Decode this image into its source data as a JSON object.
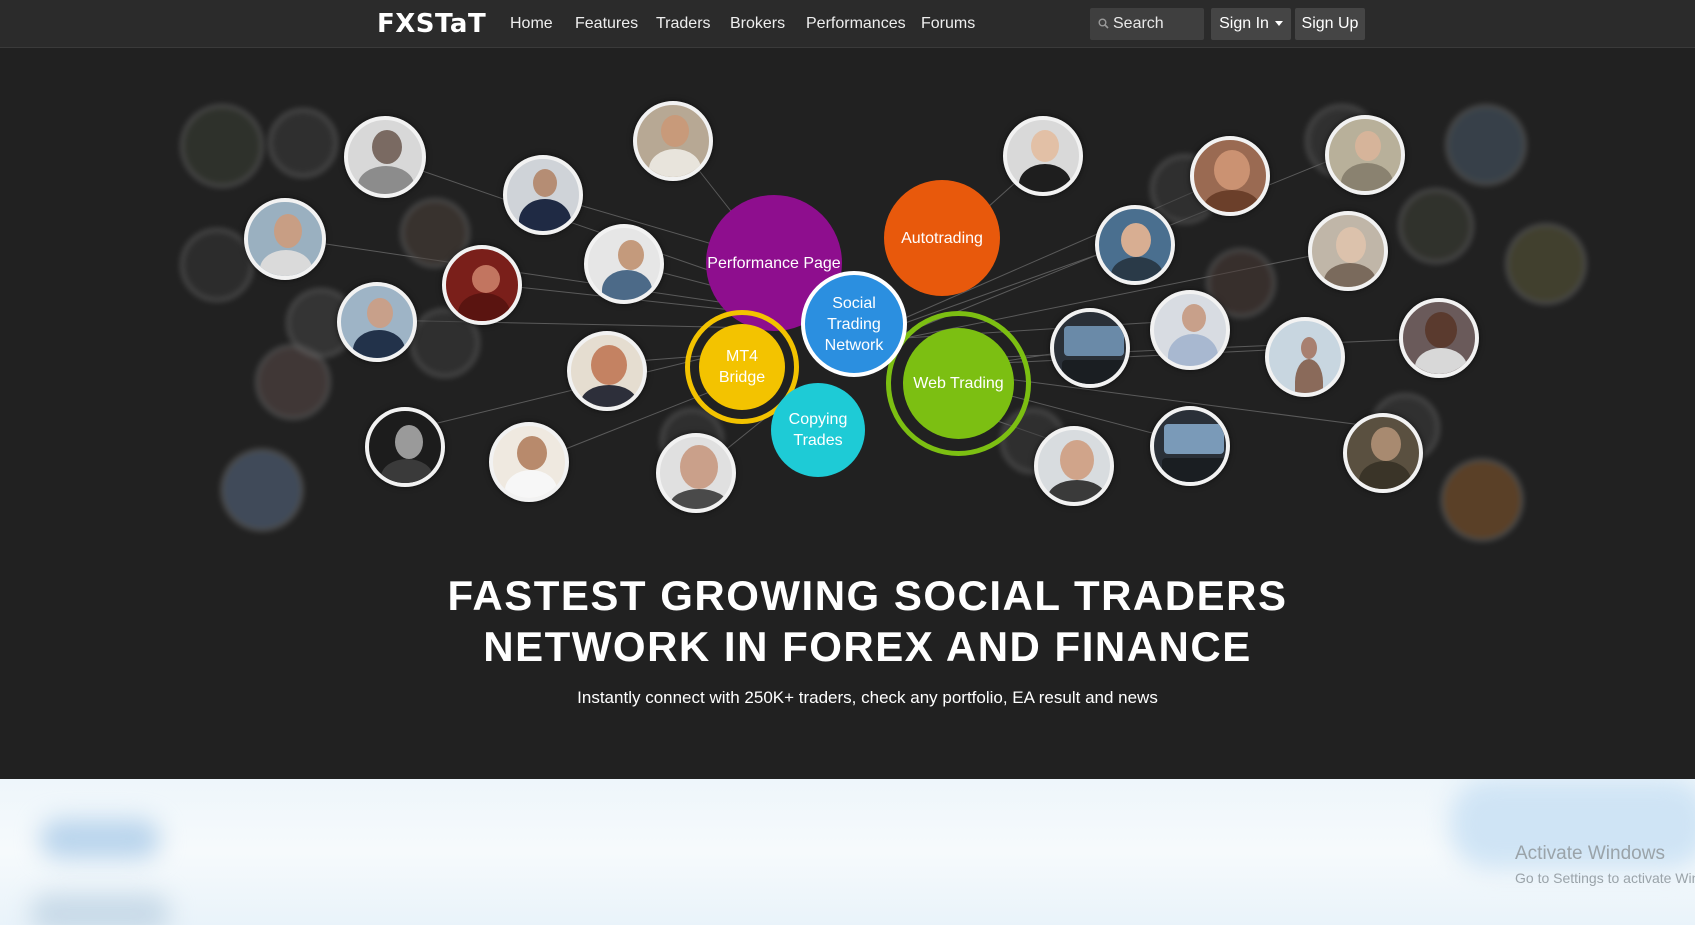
{
  "nav": {
    "brand": "FXSTaT",
    "links": [
      "Home",
      "Features",
      "Traders",
      "Brokers",
      "Performances",
      "Forums"
    ],
    "search_placeholder": "Search",
    "sign_in": "Sign In",
    "sign_up": "Sign Up"
  },
  "hero": {
    "features": {
      "performance": "Performance Page",
      "autotrading": "Autotrading",
      "social": "Social Trading Network",
      "mt4": "MT4 Bridge",
      "copying": "Copying Trades",
      "web": "Web Trading"
    },
    "title_line1": "FASTEST GROWING SOCIAL TRADERS",
    "title_line2": "NETWORK IN FOREX AND FINANCE",
    "subtitle": "Instantly connect with 250K+ traders, check any portfolio, EA result and news"
  },
  "watermark": {
    "title": "Activate Windows",
    "subtitle": "Go to Settings to activate Windows."
  },
  "colors": {
    "nav_bg": "#2b2b2b",
    "hero_bg": "#212121",
    "performance": "#8e0e8e",
    "autotrading": "#e8590c",
    "social": "#2b8fe0",
    "mt4": "#f3c300",
    "copying": "#1ecbd6",
    "web": "#7cbf12"
  }
}
